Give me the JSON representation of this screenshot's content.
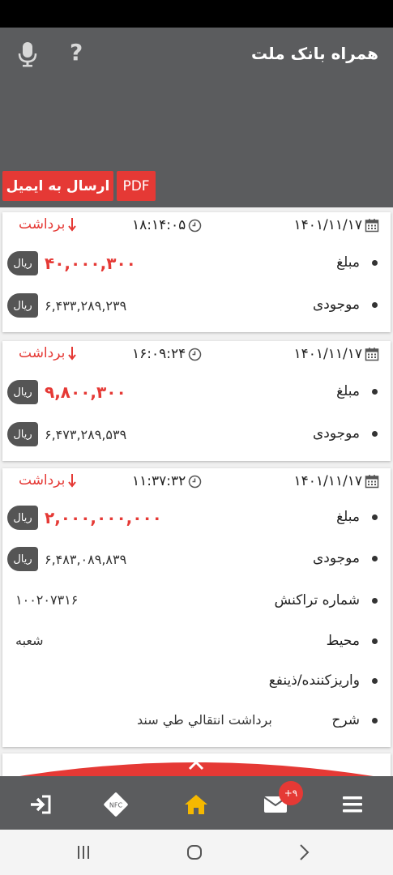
{
  "app": {
    "title": "همراه بانک ملت"
  },
  "header": {
    "icons": {
      "mic": "microphone-icon",
      "help": "help-icon"
    },
    "help_label": "?",
    "pdf_label": "PDF",
    "email_label": "ارسال به ایمیل"
  },
  "transactions": [
    {
      "date": "۱۴۰۱/۱۱/۱۷",
      "time": "۱۸:۱۴:۰۵",
      "type": "برداشت",
      "amount_label": "مبلغ",
      "amount": "۴۰,۰۰۰,۳۰۰",
      "amount_currency": "ریال",
      "balance_label": "موجودی",
      "balance": "۶,۴۳۳,۲۸۹,۲۳۹",
      "balance_currency": "ریال"
    },
    {
      "date": "۱۴۰۱/۱۱/۱۷",
      "time": "۱۶:۰۹:۲۴",
      "type": "برداشت",
      "amount_label": "مبلغ",
      "amount": "۹,۸۰۰,۳۰۰",
      "amount_currency": "ریال",
      "balance_label": "موجودی",
      "balance": "۶,۴۷۳,۲۸۹,۵۳۹",
      "balance_currency": "ریال"
    },
    {
      "date": "۱۴۰۱/۱۱/۱۷",
      "time": "۱۱:۳۷:۳۲",
      "type": "برداشت",
      "amount_label": "مبلغ",
      "amount": "۲,۰۰۰,۰۰۰,۰۰۰",
      "amount_currency": "ریال",
      "balance_label": "موجودی",
      "balance": "۶,۴۸۳,۰۸۹,۸۳۹",
      "balance_currency": "ریال",
      "tracking_label": "شماره تراکنش",
      "tracking": "۱۰۰۲۰۷۳۱۶",
      "channel_label": "محیط",
      "channel": "شعبه",
      "depositor_label": "واریزکننده/ذینفع",
      "description_label": "شرح",
      "description": "برداشت انتقالي طي سند"
    }
  ],
  "bottom_nav": {
    "items": [
      "logout-icon",
      "nfc-icon",
      "home-icon",
      "mail-icon",
      "menu-icon"
    ],
    "nfc_label": "NFC",
    "mail_badge": "+۹",
    "active": "home-icon",
    "active_color": "#f5b800"
  },
  "colors": {
    "accent": "#e53935",
    "header": "#5b5c5e"
  }
}
